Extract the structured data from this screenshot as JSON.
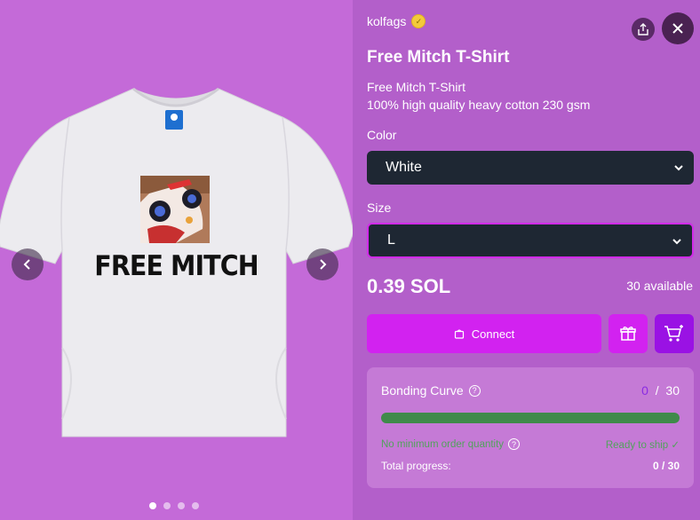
{
  "gallery": {
    "print_text": "FREE MITCH",
    "dots_count": 4,
    "active_dot": 0
  },
  "seller": {
    "name": "kolfags"
  },
  "product": {
    "title": "Free Mitch T-Shirt",
    "description_line1": "Free Mitch T-Shirt",
    "description_line2": "100% high quality heavy cotton 230 gsm"
  },
  "options": {
    "color_label": "Color",
    "color_value": "White",
    "size_label": "Size",
    "size_value": "L"
  },
  "price": {
    "amount": "0.39 SOL",
    "available": "30 available"
  },
  "actions": {
    "connect_label": "Connect"
  },
  "bonding": {
    "title": "Bonding Curve",
    "current": "0",
    "separator": "/",
    "max": "30",
    "progress_fraction": 0,
    "note": "No minimum order quantity",
    "ready": "Ready to ship ✓",
    "total_label": "Total progress:",
    "total_value": "0 / 30"
  },
  "colors": {
    "background": "#c46ad8",
    "panel": "#b35fca",
    "accent": "#d222f0",
    "cart": "#9a12e4",
    "select_bg": "#1e2733",
    "progress": "#3f8a4a"
  },
  "icons": [
    "verified-icon",
    "share-icon",
    "close-icon",
    "chevron-down-icon",
    "bag-icon",
    "gift-icon",
    "cart-plus-icon",
    "help-icon",
    "chevron-left-icon",
    "chevron-right-icon"
  ]
}
